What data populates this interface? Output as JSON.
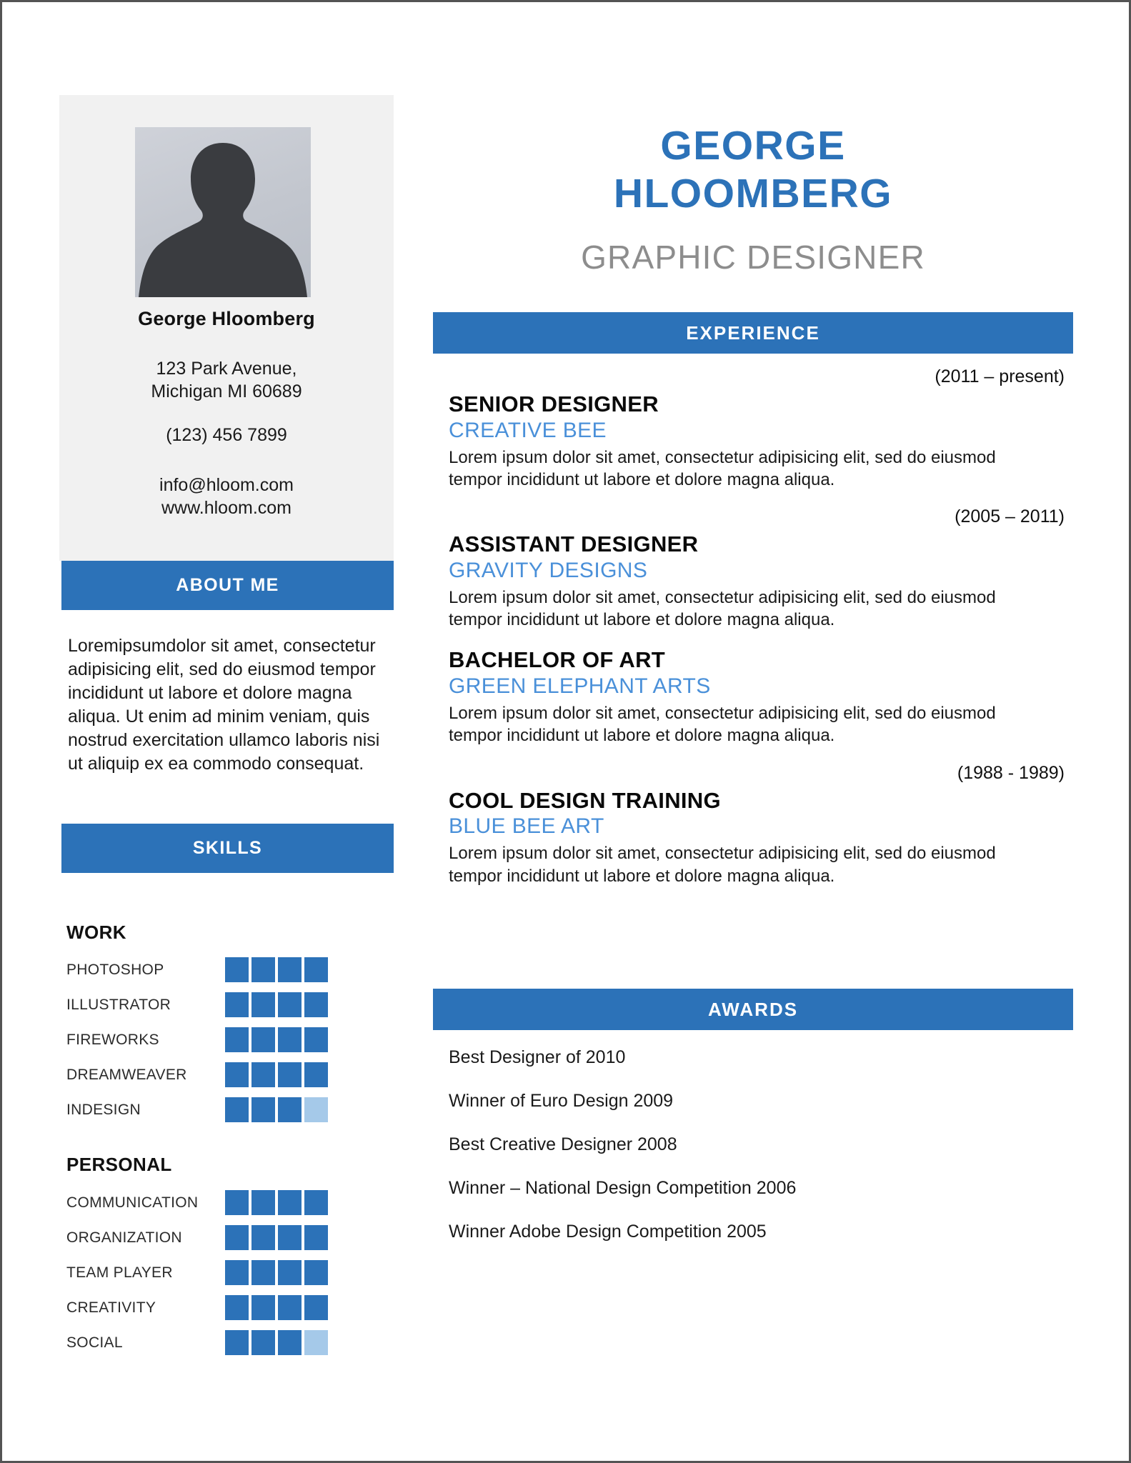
{
  "header": {
    "name_line1": "GEORGE",
    "name_line2": "HLOOMBERG",
    "job_title": "GRAPHIC DESIGNER",
    "name_color": "#2c72b8",
    "title_color": "#8d8d8d"
  },
  "sidebar": {
    "photo_alt": "person-silhouette-photo",
    "name": "George Hloomberg",
    "address_line1": "123 Park Avenue,",
    "address_line2": "Michigan MI 60689",
    "phone": "(123) 456 7899",
    "email": "info@hloom.com",
    "website": "www.hloom.com",
    "about_heading": "ABOUT ME",
    "about_text": "Loremipsumdolor sit amet, consectetur adipisicing elit, sed do eiusmod tempor incididunt ut labore et dolore magna aliqua. Ut enim ad minim veniam, quis nostrud exercitation ullamco laboris nisi ut aliquip ex ea commodo consequat.",
    "skills_heading": "SKILLS",
    "skills_groups": [
      {
        "title": "WORK",
        "items": [
          {
            "label": "PHOTOSHOP",
            "filled": 4,
            "total": 4
          },
          {
            "label": "ILLUSTRATOR",
            "filled": 4,
            "total": 4
          },
          {
            "label": "FIREWORKS",
            "filled": 4,
            "total": 4
          },
          {
            "label": "DREAMWEAVER",
            "filled": 4,
            "total": 4
          },
          {
            "label": "INDESIGN",
            "filled": 3,
            "total": 4
          }
        ]
      },
      {
        "title": "PERSONAL",
        "items": [
          {
            "label": "COMMUNICATION",
            "filled": 4,
            "total": 4
          },
          {
            "label": "ORGANIZATION",
            "filled": 4,
            "total": 4
          },
          {
            "label": "TEAM PLAYER",
            "filled": 4,
            "total": 4
          },
          {
            "label": "CREATIVITY",
            "filled": 4,
            "total": 4
          },
          {
            "label": "SOCIAL",
            "filled": 3,
            "total": 4
          }
        ]
      }
    ]
  },
  "main": {
    "experience_heading": "EXPERIENCE",
    "experience": [
      {
        "date": "(2011 – present)",
        "show_date": true,
        "role": "SENIOR DESIGNER",
        "company": "CREATIVE BEE",
        "description": "Lorem ipsum dolor sit amet, consectetur adipisicing elit, sed do eiusmod tempor incididunt ut labore et dolore magna aliqua."
      },
      {
        "date": "(2005 – 2011)",
        "show_date": true,
        "role": "ASSISTANT DESIGNER",
        "company": "GRAVITY DESIGNS",
        "description": "Lorem ipsum dolor sit amet, consectetur adipisicing elit, sed do eiusmod tempor incididunt ut labore et dolore magna aliqua."
      },
      {
        "date": "",
        "show_date": false,
        "role": "BACHELOR OF ART",
        "company": "GREEN ELEPHANT ARTS",
        "description": "Lorem ipsum dolor sit amet, consectetur adipisicing elit, sed do eiusmod tempor incididunt ut labore et dolore magna aliqua."
      },
      {
        "date": "(1988 - 1989)",
        "show_date": true,
        "role": "COOL DESIGN TRAINING",
        "company": "BLUE BEE ART",
        "description": "Lorem ipsum dolor sit amet, consectetur adipisicing elit, sed do eiusmod tempor incididunt ut labore et dolore magna aliqua."
      }
    ],
    "awards_heading": "AWARDS",
    "awards": [
      "Best Designer of 2010",
      "Winner of Euro Design 2009",
      "Best Creative Designer 2008",
      "Winner – National Design Competition 2006",
      "Winner Adobe Design Competition 2005"
    ]
  },
  "theme": {
    "accent_blue": "#2c72b8",
    "light_blue": "#a5c9e9",
    "company_blue": "#4a90d9",
    "sidebar_gray": "#f1f1f1",
    "subtitle_gray": "#8d8d8d"
  }
}
